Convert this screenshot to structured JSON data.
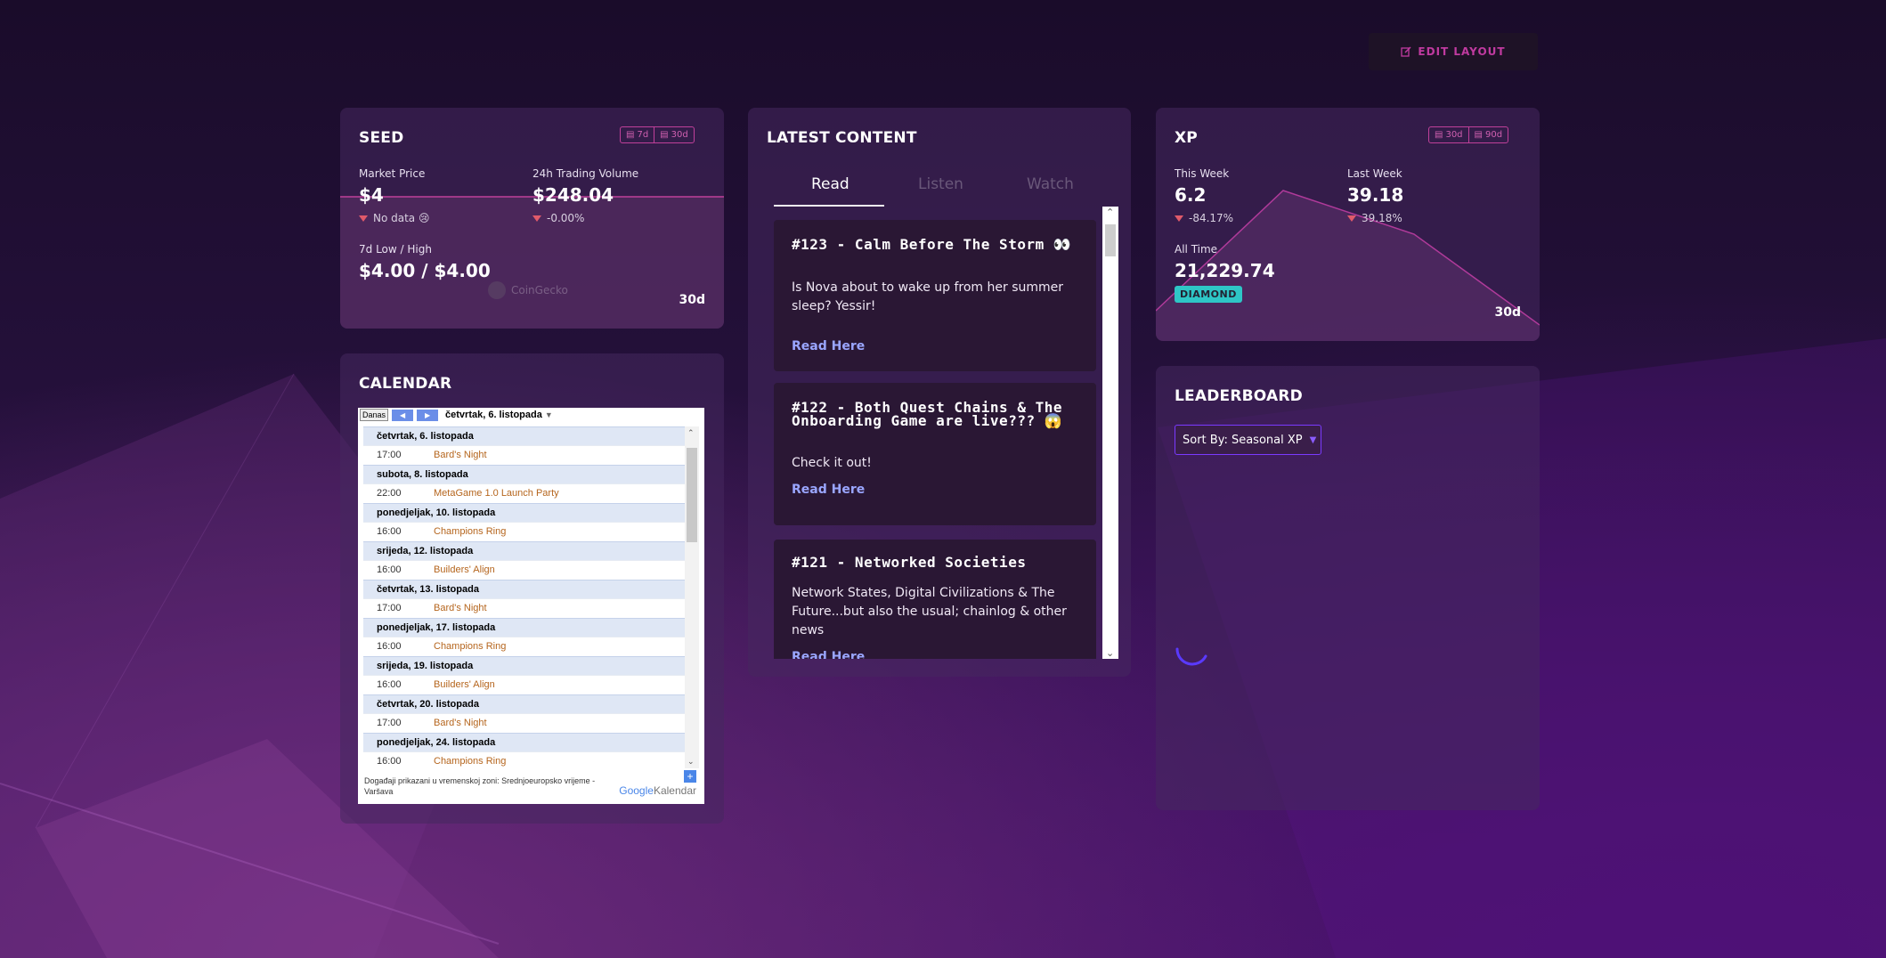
{
  "toolbar": {
    "edit_layout_label": "EDIT LAYOUT"
  },
  "seed": {
    "title": "SEED",
    "ranges": [
      "7d",
      "30d"
    ],
    "market_price_label": "Market Price",
    "market_price": "$4",
    "market_price_delta": "No data 😢",
    "volume_label": "24h Trading Volume",
    "volume": "$248.04",
    "volume_delta": "-0.00%",
    "lowhigh_label": "7d Low / High",
    "lowhigh": "$4.00 / $4.00",
    "source": "CoinGecko",
    "period": "30d"
  },
  "calendar": {
    "title": "CALENDAR",
    "today_btn": "Danas",
    "current_date": "četvrtak, 6. listopada",
    "days": [
      {
        "label": "četvrtak, 6. listopada",
        "events": [
          {
            "time": "17:00",
            "name": "Bard's Night"
          }
        ]
      },
      {
        "label": "subota, 8. listopada",
        "events": [
          {
            "time": "22:00",
            "name": "MetaGame 1.0 Launch Party"
          }
        ]
      },
      {
        "label": "ponedjeljak, 10. listopada",
        "events": [
          {
            "time": "16:00",
            "name": "Champions Ring"
          }
        ]
      },
      {
        "label": "srijeda, 12. listopada",
        "events": [
          {
            "time": "16:00",
            "name": "Builders' Align"
          }
        ]
      },
      {
        "label": "četvrtak, 13. listopada",
        "events": [
          {
            "time": "17:00",
            "name": "Bard's Night"
          }
        ]
      },
      {
        "label": "ponedjeljak, 17. listopada",
        "events": [
          {
            "time": "16:00",
            "name": "Champions Ring"
          }
        ]
      },
      {
        "label": "srijeda, 19. listopada",
        "events": [
          {
            "time": "16:00",
            "name": "Builders' Align"
          }
        ]
      },
      {
        "label": "četvrtak, 20. listopada",
        "events": [
          {
            "time": "17:00",
            "name": "Bard's Night"
          }
        ]
      },
      {
        "label": "ponedjeljak, 24. listopada",
        "events": [
          {
            "time": "16:00",
            "name": "Champions Ring"
          }
        ]
      }
    ],
    "footer": "Događaji prikazani u vremenskoj zoni: Srednjoeuropsko vrijeme - Varšava",
    "google": "Google",
    "kalendar": "Kalendar"
  },
  "content": {
    "title": "LATEST CONTENT",
    "tabs": [
      "Read",
      "Listen",
      "Watch"
    ],
    "active_tab": "Read",
    "items": [
      {
        "title": "#123 - Calm Before The Storm 👀",
        "text": "Is Nova about to wake up from her summer sleep? Yessir!",
        "link": "Read Here"
      },
      {
        "title": "#122 - Both Quest Chains & The Onboarding Game are live??? 😱",
        "text": "Check it out!",
        "link": "Read Here"
      },
      {
        "title": "#121 - Networked Societies",
        "text": "Network States, Digital Civilizations & The Future...but also the usual; chainlog & other news",
        "link": "Read Here"
      }
    ]
  },
  "xp": {
    "title": "XP",
    "ranges": [
      "30d",
      "90d"
    ],
    "this_week_label": "This Week",
    "this_week": "6.2",
    "this_week_delta": "-84.17%",
    "last_week_label": "Last Week",
    "last_week": "39.18",
    "last_week_delta": "39.18%",
    "all_time_label": "All Time",
    "all_time": "21,229.74",
    "rank": "DIAMOND",
    "period": "30d"
  },
  "leaderboard": {
    "title": "LEADERBOARD",
    "sort_label": "Sort By: Seasonal XP"
  }
}
